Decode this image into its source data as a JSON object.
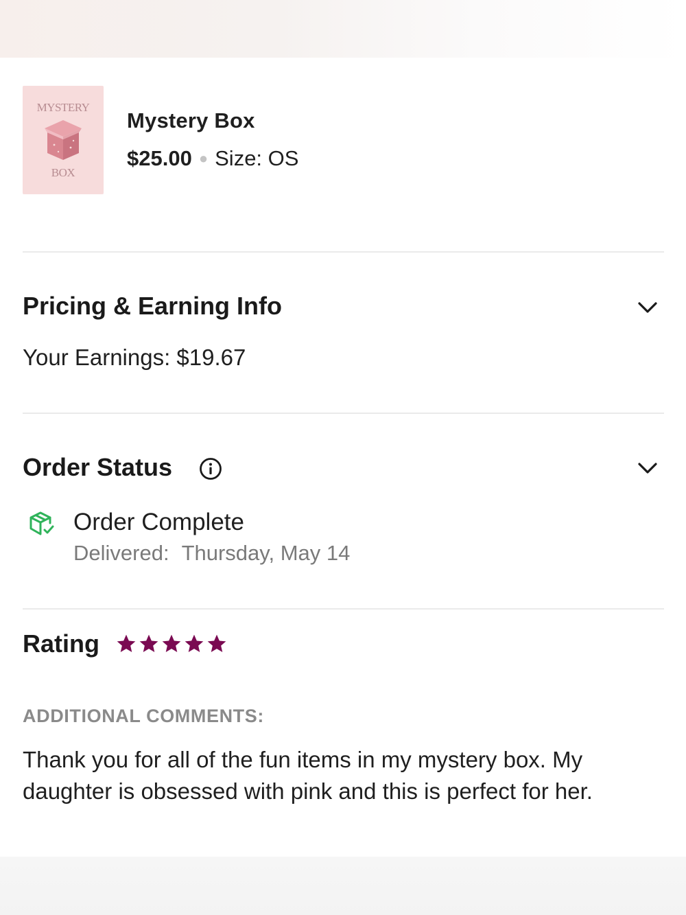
{
  "product": {
    "thumbnail_top_text": "MYSTERY",
    "thumbnail_bottom_text": "BOX",
    "name": "Mystery Box",
    "price": "$25.00",
    "size": "Size: OS"
  },
  "pricing": {
    "title": "Pricing & Earning Info",
    "earnings": "Your Earnings: $19.67"
  },
  "order_status": {
    "title": "Order Status",
    "status": "Order Complete",
    "delivered_label": "Delivered:",
    "delivered_date": "Thursday, May 14"
  },
  "rating": {
    "title": "Rating",
    "stars": 5,
    "max_stars": 5,
    "star_color": "#7a0a52"
  },
  "comments": {
    "label": "ADDITIONAL COMMENTS:",
    "text": "Thank you for all of the fun items in my mystery box. My daughter is obsessed with pink and this is perfect for her."
  },
  "colors": {
    "status_green": "#2fb35a",
    "star_purple": "#7a0a52",
    "label_gray": "#8a8a8a"
  },
  "icons": {
    "pricing_toggle": "chevron-down-icon",
    "status_toggle": "chevron-down-icon",
    "status_info": "info-icon",
    "status_delivered": "package-check-icon",
    "rating_star": "star-icon"
  }
}
